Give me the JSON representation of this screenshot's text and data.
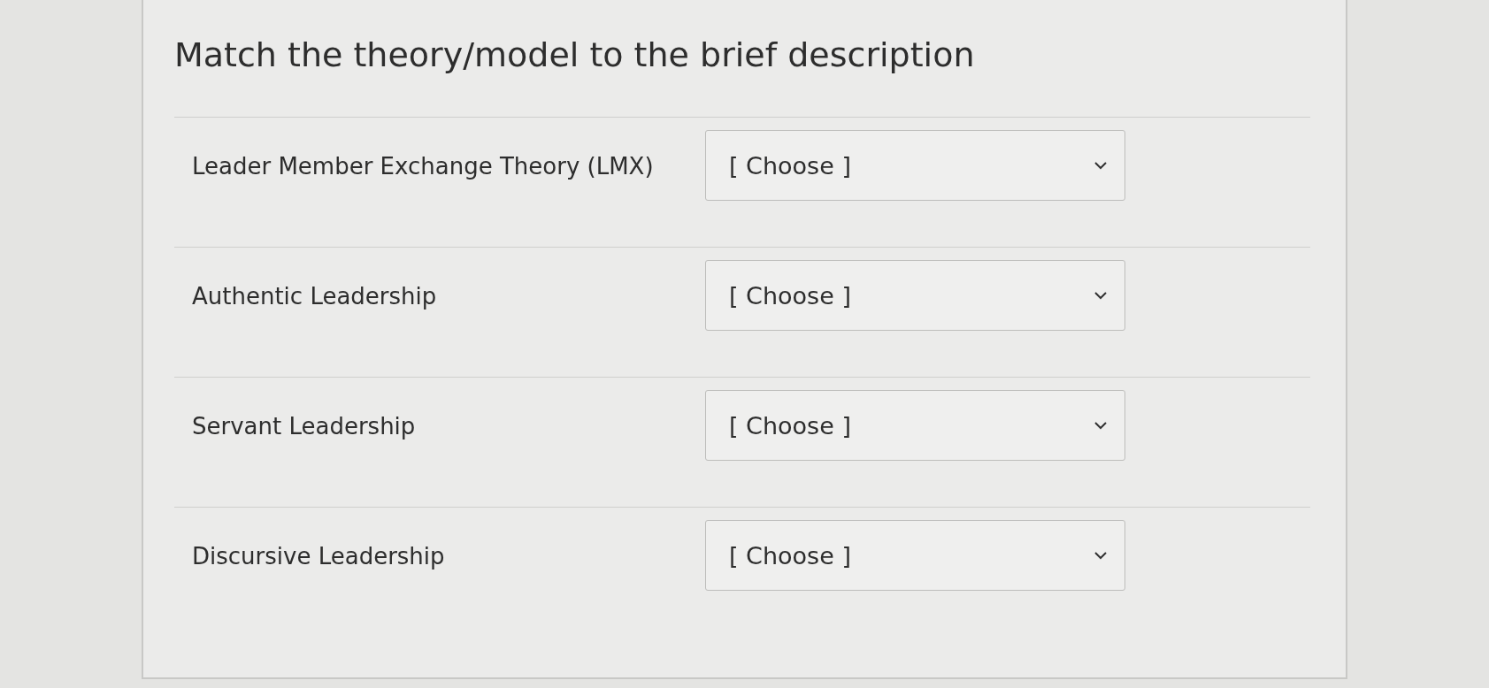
{
  "question": {
    "title": "Match the theory/model to the brief description",
    "rows": [
      {
        "label": "Leader Member Exchange Theory (LMX)",
        "select": "[ Choose ]"
      },
      {
        "label": "Authentic Leadership",
        "select": "[ Choose ]"
      },
      {
        "label": "Servant Leadership",
        "select": "[ Choose ]"
      },
      {
        "label": "Discursive Leadership",
        "select": "[ Choose ]"
      }
    ]
  }
}
